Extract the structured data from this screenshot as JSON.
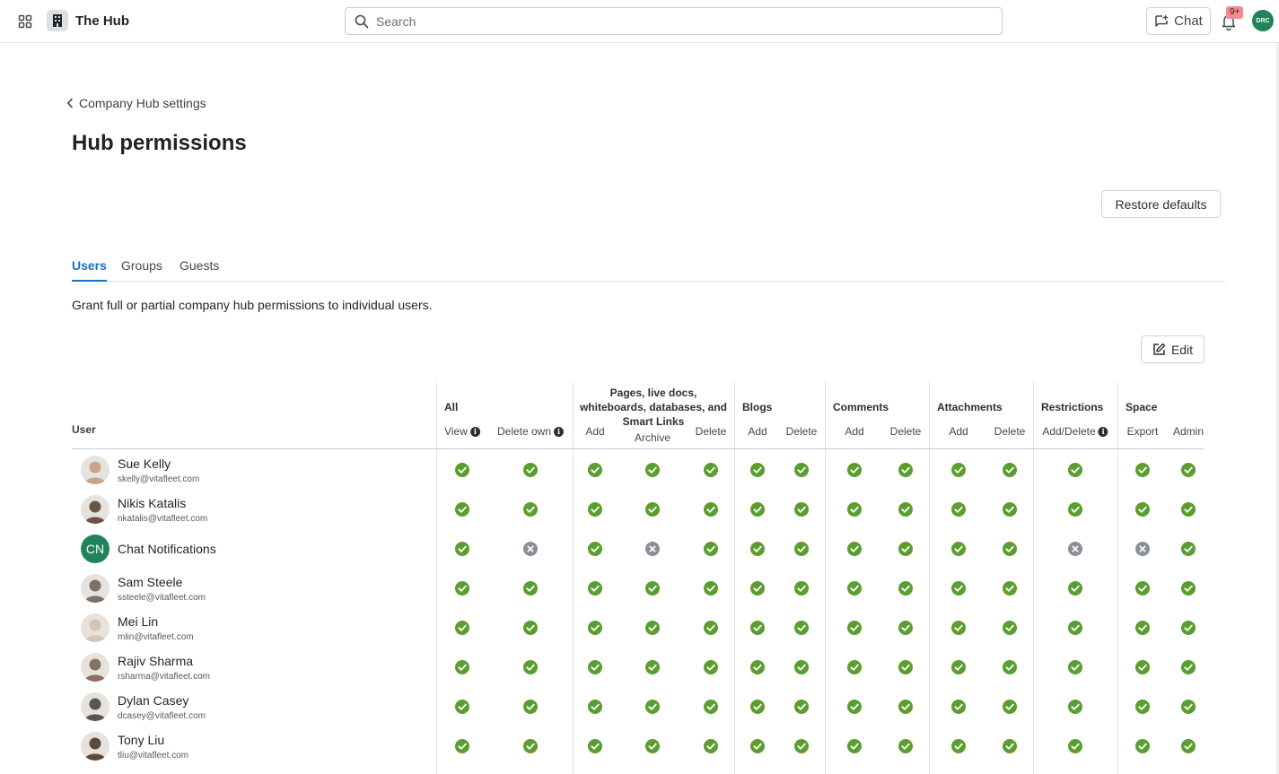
{
  "topbar": {
    "brand_name": "The Hub",
    "search_placeholder": "Search",
    "chat_label": "Chat",
    "notification_badge": "9+",
    "user_initials": "DRC"
  },
  "page": {
    "back_label": "Company Hub settings",
    "title": "Hub permissions",
    "restore_label": "Restore defaults",
    "tabs": [
      {
        "label": "Users",
        "active": true
      },
      {
        "label": "Groups",
        "active": false
      },
      {
        "label": "Guests",
        "active": false
      }
    ],
    "description": "Grant full or partial company hub permissions to individual users.",
    "edit_label": "Edit"
  },
  "table": {
    "user_column_label": "User",
    "groups": [
      {
        "label": "All"
      },
      {
        "label": "Pages, live docs, whiteboards, databases, and Smart Links"
      },
      {
        "label": "Blogs"
      },
      {
        "label": "Comments"
      },
      {
        "label": "Attachments"
      },
      {
        "label": "Restrictions"
      },
      {
        "label": "Space"
      }
    ],
    "columns": [
      {
        "label": "View",
        "info": true
      },
      {
        "label": "Delete own",
        "info": true
      },
      {
        "label": "Add"
      },
      {
        "label": "Archive"
      },
      {
        "label": "Delete"
      },
      {
        "label": "Add"
      },
      {
        "label": "Delete"
      },
      {
        "label": "Add"
      },
      {
        "label": "Delete"
      },
      {
        "label": "Add"
      },
      {
        "label": "Delete"
      },
      {
        "label": "Add/Delete",
        "info": true
      },
      {
        "label": "Export"
      },
      {
        "label": "Admin"
      }
    ],
    "rows": [
      {
        "name": "Sue Kelly",
        "email": "skelly@vitafleet.com",
        "avatar": "photo",
        "perms": [
          true,
          true,
          true,
          true,
          true,
          true,
          true,
          true,
          true,
          true,
          true,
          true,
          true,
          true
        ]
      },
      {
        "name": "Nikis Katalis",
        "email": "nkatalis@vitafleet.com",
        "avatar": "photo",
        "perms": [
          true,
          true,
          true,
          true,
          true,
          true,
          true,
          true,
          true,
          true,
          true,
          true,
          true,
          true
        ]
      },
      {
        "name": "Chat Notifications",
        "email": "",
        "avatar": "initials",
        "initials": "CN",
        "perms": [
          true,
          false,
          true,
          false,
          true,
          true,
          true,
          true,
          true,
          true,
          true,
          false,
          false,
          true
        ]
      },
      {
        "name": "Sam Steele",
        "email": "ssteele@vitafleet.com",
        "avatar": "photo",
        "perms": [
          true,
          true,
          true,
          true,
          true,
          true,
          true,
          true,
          true,
          true,
          true,
          true,
          true,
          true
        ]
      },
      {
        "name": "Mei Lin",
        "email": "mlin@vitafleet.com",
        "avatar": "photo",
        "perms": [
          true,
          true,
          true,
          true,
          true,
          true,
          true,
          true,
          true,
          true,
          true,
          true,
          true,
          true
        ]
      },
      {
        "name": "Rajiv Sharma",
        "email": "rsharma@vitafleet.com",
        "avatar": "photo",
        "perms": [
          true,
          true,
          true,
          true,
          true,
          true,
          true,
          true,
          true,
          true,
          true,
          true,
          true,
          true
        ]
      },
      {
        "name": "Dylan Casey",
        "email": "dcasey@vitafleet.com",
        "avatar": "photo",
        "perms": [
          true,
          true,
          true,
          true,
          true,
          true,
          true,
          true,
          true,
          true,
          true,
          true,
          true,
          true
        ]
      },
      {
        "name": "Tony Liu",
        "email": "tliu@vitafleet.com",
        "avatar": "photo",
        "perms": [
          true,
          true,
          true,
          true,
          true,
          true,
          true,
          true,
          true,
          true,
          true,
          true,
          true,
          true
        ]
      }
    ]
  }
}
